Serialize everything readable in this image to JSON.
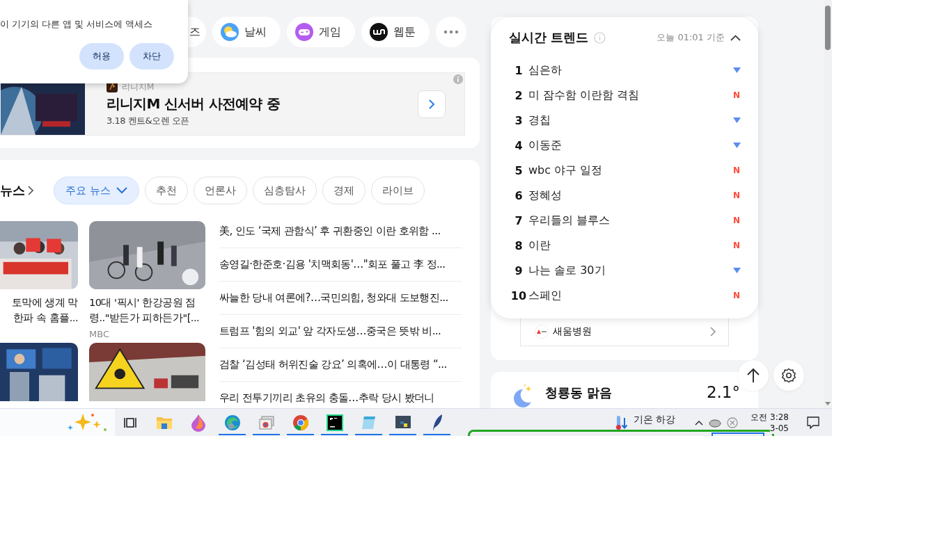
{
  "permission_popup": {
    "message": "이 기기의 다른 앱 및 서비스에 액세스",
    "buttons": [
      "허용",
      "차단"
    ]
  },
  "shortcuts": [
    {
      "label": "즈",
      "kind": "partial"
    },
    {
      "label": "날씨",
      "kind": "weather"
    },
    {
      "label": "게임",
      "kind": "game"
    },
    {
      "label": "웹툰",
      "kind": "webtoon"
    },
    {
      "kind": "more"
    }
  ],
  "ad": {
    "brand": "리니지M",
    "title": "리니지M 신서버 사전예약 중",
    "subtitle": "3.18 켄트&오렌 오픈"
  },
  "news": {
    "section_title": "뉴스",
    "tabs": [
      {
        "label": "주요 뉴스",
        "selected": true
      },
      {
        "label": "추천",
        "selected": false
      },
      {
        "label": "언론사",
        "selected": false
      },
      {
        "label": "심층탐사",
        "selected": false
      },
      {
        "label": "경제",
        "selected": false
      },
      {
        "label": "라이브",
        "selected": false
      }
    ],
    "cards": [
      {
        "caption": [
          "토막에 생계 막",
          "한파 속 홈플..."
        ]
      },
      {
        "caption": [
          "10대 '픽시' 한강공원 점",
          "령..\"받든가 피하든가\"[..."
        ],
        "source": "MBC"
      }
    ],
    "headlines": [
      "美, 인도 ‘국제 관함식’ 후 귀환중인 이란 호위함 ...",
      "송영길·한준호·김용 '치맥회동'…\"회포 풀고 李 정...",
      "싸늘한 당내 여론에?…국민의힘, 청와대 도보행진...",
      "트럼프 '힘의 외교' 앞 각자도생…중국은 뜻밖 비...",
      "검찰 ‘김성태 허위진술 강요’ 의혹에…이 대통령 “...",
      "우리 전투기끼리 초유의 충돌…추락 당시 봤더니"
    ]
  },
  "trends": {
    "title": "실시간 트렌드",
    "updated": "오늘 01:01 기준",
    "items": [
      {
        "rank": "1",
        "keyword": "심은하",
        "kind": "down"
      },
      {
        "rank": "2",
        "keyword": "미 잠수함 이란함 격침",
        "kind": "new",
        "badge": "N"
      },
      {
        "rank": "3",
        "keyword": "경칩",
        "kind": "down"
      },
      {
        "rank": "4",
        "keyword": "이동준",
        "kind": "down"
      },
      {
        "rank": "5",
        "keyword": "wbc 야구 일정",
        "kind": "new",
        "badge": "N"
      },
      {
        "rank": "6",
        "keyword": "정혜성",
        "kind": "new",
        "badge": "N"
      },
      {
        "rank": "7",
        "keyword": "우리들의 블루스",
        "kind": "new",
        "badge": "N"
      },
      {
        "rank": "8",
        "keyword": "이란",
        "kind": "new",
        "badge": "N"
      },
      {
        "rank": "9",
        "keyword": "나는 솔로 30기",
        "kind": "down"
      },
      {
        "rank": "10",
        "keyword": "스페인",
        "kind": "new",
        "badge": "N"
      }
    ]
  },
  "sponsor": {
    "label": "새움병원"
  },
  "weather": {
    "title": "청룡동 맑음",
    "temperature": "2.1°"
  },
  "taskbar": {
    "apps": [
      {
        "kind": "taskview",
        "running": false
      },
      {
        "kind": "folder",
        "running": false
      },
      {
        "kind": "drop",
        "running": false
      },
      {
        "kind": "edge",
        "running": true
      },
      {
        "kind": "windows",
        "running": true
      },
      {
        "kind": "chrome",
        "running": true
      },
      {
        "kind": "pycharm",
        "running": true
      },
      {
        "kind": "notepad",
        "running": true
      },
      {
        "kind": "python",
        "running": true
      },
      {
        "kind": "feather",
        "running": true
      }
    ],
    "weather_text": "기온 하강",
    "time": "오전 3:28",
    "date": "3-05"
  }
}
